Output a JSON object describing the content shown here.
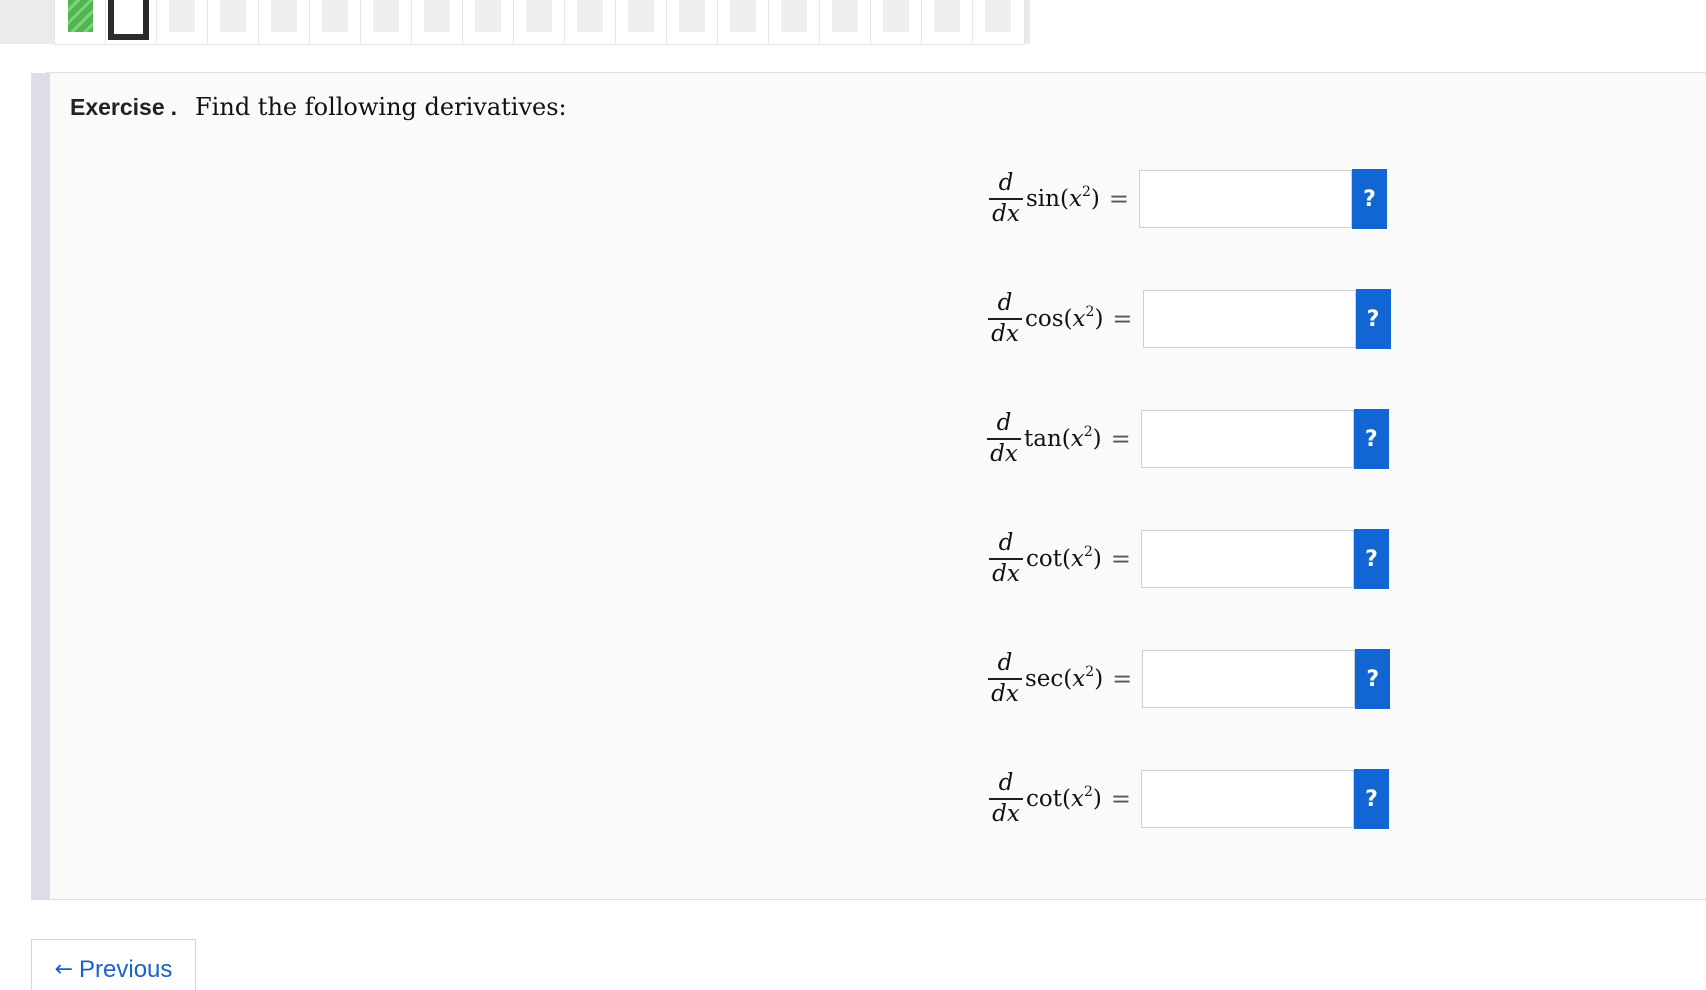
{
  "progress": {
    "total_steps": 19,
    "completed_steps": 1,
    "current_step": 2
  },
  "exercise": {
    "label": "Exercise",
    "dot": ".",
    "prompt": "Find the following derivatives:"
  },
  "derivatives": [
    {
      "numerator": "d",
      "denominator": "dx",
      "function": "sin",
      "variable": "x",
      "exponent": "2",
      "equals": "=",
      "answer": "",
      "help_label": "?"
    },
    {
      "numerator": "d",
      "denominator": "dx",
      "function": "cos",
      "variable": "x",
      "exponent": "2",
      "equals": "=",
      "answer": "",
      "help_label": "?"
    },
    {
      "numerator": "d",
      "denominator": "dx",
      "function": "tan",
      "variable": "x",
      "exponent": "2",
      "equals": "=",
      "answer": "",
      "help_label": "?"
    },
    {
      "numerator": "d",
      "denominator": "dx",
      "function": "cot",
      "variable": "x",
      "exponent": "2",
      "equals": "=",
      "answer": "",
      "help_label": "?"
    },
    {
      "numerator": "d",
      "denominator": "dx",
      "function": "sec",
      "variable": "x",
      "exponent": "2",
      "equals": "=",
      "answer": "",
      "help_label": "?"
    },
    {
      "numerator": "d",
      "denominator": "dx",
      "function": "cot",
      "variable": "x",
      "exponent": "2",
      "equals": "=",
      "answer": "",
      "help_label": "?"
    }
  ],
  "navigation": {
    "previous_arrow": "←",
    "previous_label": "Previous"
  },
  "colors": {
    "accent": "#1266d3",
    "completed": "#4fb74f",
    "current": "#2b2b2b",
    "exercise_bar": "#dcdde9"
  }
}
